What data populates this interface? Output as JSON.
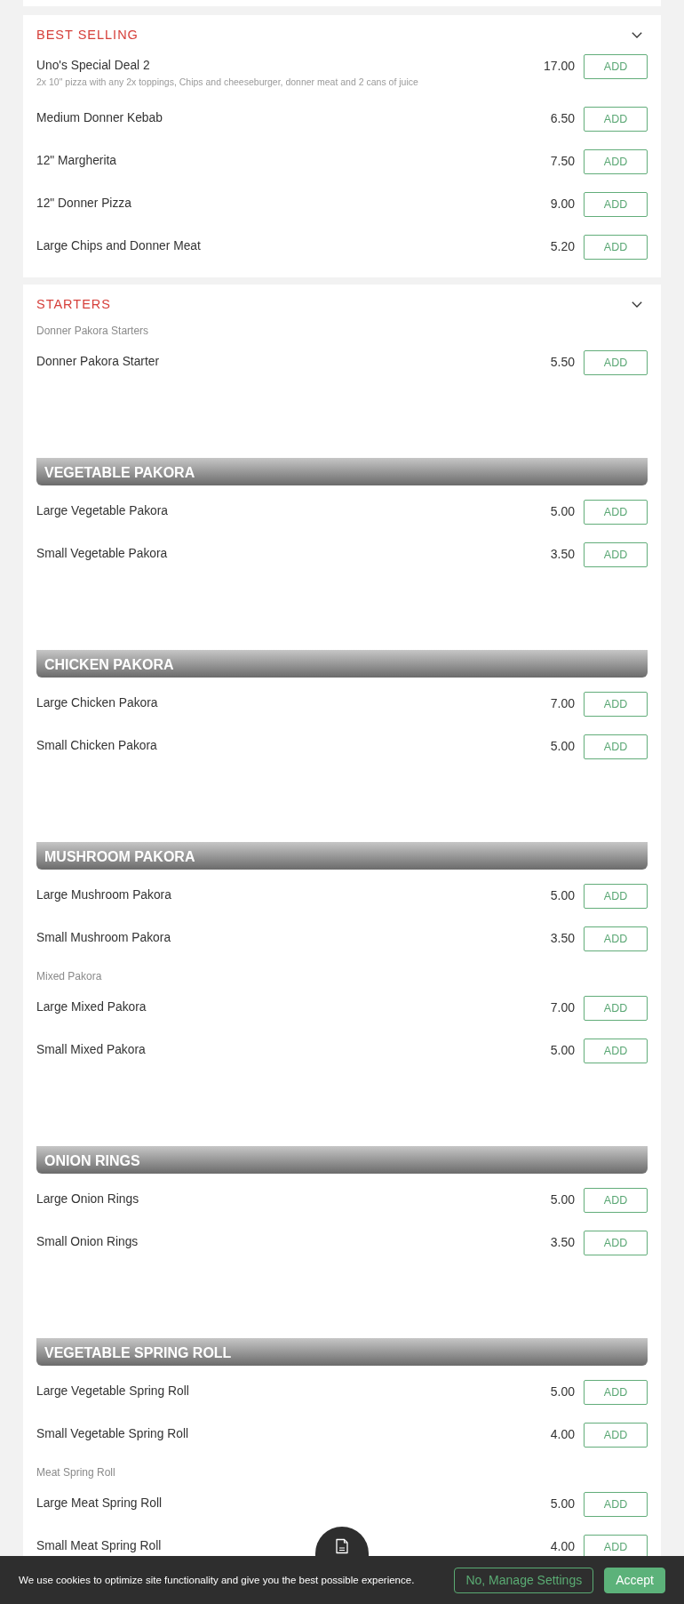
{
  "sections": [
    {
      "title": "BEST SELLING",
      "entries": [
        {
          "kind": "item",
          "name": "Uno's Special Deal 2",
          "description": "2x 10\" pizza with any 2x toppings, Chips and cheeseburger, donner meat and 2 cans of juice",
          "price": "17.00",
          "button": "ADD"
        },
        {
          "kind": "item",
          "name": "Medium Donner Kebab",
          "price": "6.50",
          "button": "ADD"
        },
        {
          "kind": "item",
          "name": "12\" Margherita",
          "price": "7.50",
          "button": "ADD"
        },
        {
          "kind": "item",
          "name": "12\" Donner Pizza",
          "price": "9.00",
          "button": "ADD"
        },
        {
          "kind": "item",
          "name": "Large Chips and Donner Meat",
          "price": "5.20",
          "button": "ADD"
        }
      ]
    },
    {
      "title": "STARTERS",
      "entries": [
        {
          "kind": "subheading",
          "text": "Donner Pakora Starters"
        },
        {
          "kind": "item",
          "name": "Donner Pakora Starter",
          "price": "5.50",
          "button": "ADD"
        },
        {
          "kind": "banner",
          "text": "VEGETABLE PAKORA"
        },
        {
          "kind": "item",
          "name": "Large Vegetable Pakora",
          "price": "5.00",
          "button": "ADD"
        },
        {
          "kind": "item",
          "name": "Small Vegetable Pakora",
          "price": "3.50",
          "button": "ADD"
        },
        {
          "kind": "banner",
          "text": "CHICKEN PAKORA"
        },
        {
          "kind": "item",
          "name": "Large Chicken Pakora",
          "price": "7.00",
          "button": "ADD"
        },
        {
          "kind": "item",
          "name": "Small Chicken Pakora",
          "price": "5.00",
          "button": "ADD"
        },
        {
          "kind": "banner",
          "text": "MUSHROOM PAKORA"
        },
        {
          "kind": "item",
          "name": "Large Mushroom Pakora",
          "price": "5.00",
          "button": "ADD"
        },
        {
          "kind": "item",
          "name": "Small Mushroom Pakora",
          "price": "3.50",
          "button": "ADD"
        },
        {
          "kind": "subheading",
          "text": "Mixed Pakora"
        },
        {
          "kind": "item",
          "name": "Large Mixed Pakora",
          "price": "7.00",
          "button": "ADD"
        },
        {
          "kind": "item",
          "name": "Small Mixed Pakora",
          "price": "5.00",
          "button": "ADD"
        },
        {
          "kind": "banner",
          "text": "ONION RINGS"
        },
        {
          "kind": "item",
          "name": "Large Onion Rings",
          "price": "5.00",
          "button": "ADD"
        },
        {
          "kind": "item",
          "name": "Small Onion Rings",
          "price": "3.50",
          "button": "ADD"
        },
        {
          "kind": "banner",
          "text": "VEGETABLE SPRING ROLL"
        },
        {
          "kind": "item",
          "name": "Large Vegetable Spring Roll",
          "price": "5.00",
          "button": "ADD"
        },
        {
          "kind": "item",
          "name": "Small Vegetable Spring Roll",
          "price": "4.00",
          "button": "ADD"
        },
        {
          "kind": "subheading",
          "text": "Meat Spring Roll"
        },
        {
          "kind": "item",
          "name": "Large Meat Spring Roll",
          "price": "5.00",
          "button": "ADD"
        },
        {
          "kind": "item",
          "name": "Small Meat Spring Roll",
          "price": "4.00",
          "button": "ADD"
        }
      ]
    }
  ],
  "cookie_bar": {
    "message": "We use cookies to optimize site functionality and give you the best possible experience.",
    "buttons": [
      {
        "kind": "outline",
        "label": "No, Manage Settings"
      },
      {
        "kind": "filled",
        "label": "Accept"
      }
    ]
  }
}
